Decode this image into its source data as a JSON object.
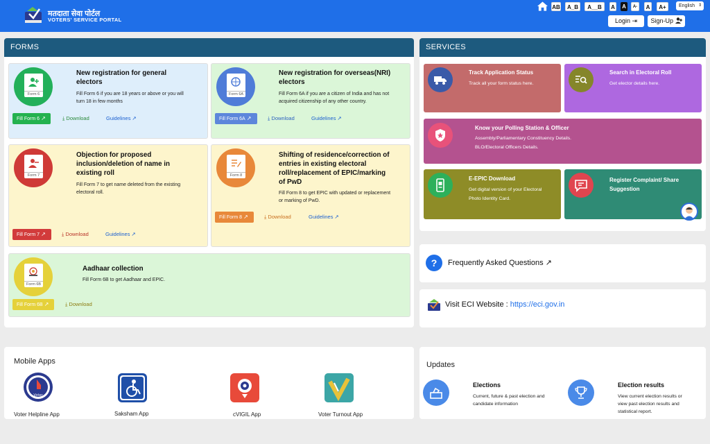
{
  "header": {
    "brand_hindi": "मतदाता सेवा पोर्टल",
    "brand_english": "VOTERS' SERVICE PORTAL",
    "text_buttons": [
      "AB",
      "A_B",
      "A__B",
      "A",
      "A",
      "A-",
      "A",
      "A+"
    ],
    "language": "English",
    "login_label": "Login",
    "signup_label": "Sign-Up"
  },
  "forms": {
    "heading": "FORMS",
    "cards": [
      {
        "form_label": "Form 6",
        "title_line1": "New registration for general",
        "title_line2": "electors",
        "desc_line1": "Fill Form 6 if you are 18 years or above or you will",
        "desc_line2": "turn 18 in few months",
        "fill_label": "Fill Form 6",
        "download_label": "Download",
        "guidelines_label": "Guidelines"
      },
      {
        "form_label": "Form 6A",
        "title_line1": "New registration for overseas(NRI)",
        "title_line2": "electors",
        "desc_line1": "Fill Form 6A if you are a citizen of India and has not",
        "desc_line2": "acquired citizenship of any other country.",
        "fill_label": "Fill Form 6A",
        "download_label": "Download",
        "guidelines_label": "Guidelines"
      },
      {
        "form_label": "Form 7",
        "title_line1": "Objection for proposed",
        "title_line2": "inclusion/deletion of name in",
        "title_line3": "existing roll",
        "desc_line1": "Fill Form 7 to get name deleted from the existing",
        "desc_line2": "electoral roll.",
        "fill_label": "Fill Form 7",
        "download_label": "Download",
        "guidelines_label": "Guidelines"
      },
      {
        "form_label": "Form 8",
        "title_line1": "Shifting of residence/correction of",
        "title_line2": "entries in existing electoral",
        "title_line3": "roll/replacement of EPIC/marking",
        "title_line4": "of PwD",
        "desc_line1": "Fill Form 8 to get EPIC with updated or replacement",
        "desc_line2": "or marking of PwD.",
        "fill_label": "Fill Form 8",
        "download_label": "Download",
        "guidelines_label": "Guidelines"
      },
      {
        "form_label": "Form 6B",
        "title_line1": "Aadhaar collection",
        "desc_line1": "Fill Form 6B to get Aadhaar and EPIC.",
        "fill_label": "Fill Form 6B",
        "download_label": "Download"
      }
    ]
  },
  "services": {
    "heading": "SERVICES",
    "track": {
      "title": "Track Application Status",
      "desc": "Track all your form status here."
    },
    "search": {
      "title": "Search in Electoral Roll",
      "desc": "Get elector details here."
    },
    "polling": {
      "title": "Know your Polling Station & Officer",
      "desc1": "Assembly/Parliamentary Constituency Details.",
      "desc2": "BLO/Electoral Officers Details."
    },
    "epic": {
      "title": "E-EPIC Download",
      "desc1": "Get digital version of your Electoral",
      "desc2": "Photo Identity Card."
    },
    "complaint": {
      "title_line1": "Register Complaint/ Share",
      "title_line2": "Suggestion"
    }
  },
  "faq": {
    "label": "Frequently Asked Questions"
  },
  "eci": {
    "label": "Visit ECI Website : ",
    "url": "https://eci.gov.in"
  },
  "mobile_apps": {
    "heading": "Mobile Apps",
    "apps": [
      {
        "name": "Voter Helpline App",
        "icon_text": "Voter"
      },
      {
        "name": "Saksham App"
      },
      {
        "name": "cVIGIL App"
      },
      {
        "name": "Voter Turnout App"
      }
    ]
  },
  "updates": {
    "heading": "Updates",
    "items": [
      {
        "title": "Elections",
        "desc1": "Current, future & past election and",
        "desc2": "candidate information"
      },
      {
        "title": "Election results",
        "desc1": "View current election results or",
        "desc2": "view past election results and",
        "desc3": "statistical report."
      }
    ]
  },
  "colors": {
    "header_blue": "#1f6fe8",
    "panel_header": "#1d5a7e",
    "track_tile": "#c36b6b",
    "search_tile": "#ae68e0",
    "polling_tile": "#b4528f",
    "epic_tile": "#8e8c27",
    "complaint_tile": "#2f8b75"
  }
}
